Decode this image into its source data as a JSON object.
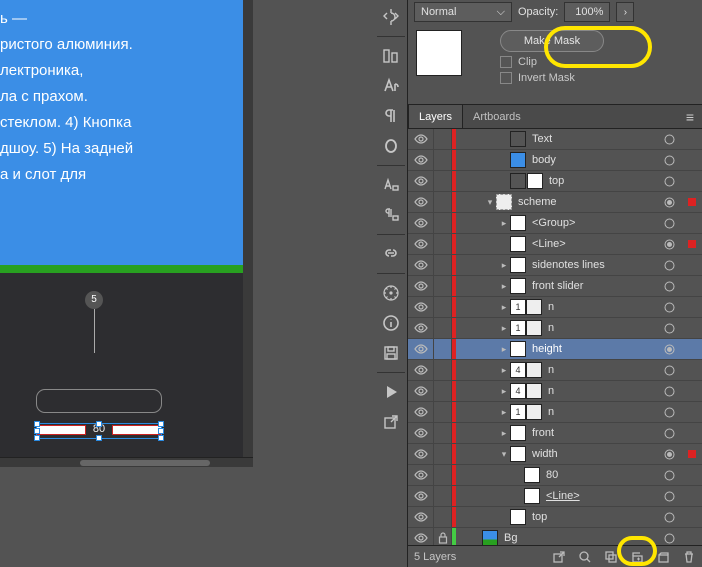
{
  "canvas": {
    "paragraph": "ь — \nристого алюминия. \nлектроника, \nла с прахом. \n стеклом. 4) Кнопка \nдшоу. 5) На задней \nа и слот для",
    "callout_number": "5",
    "sel_label": "80"
  },
  "transparency": {
    "blend_mode": "Normal",
    "opacity_label": "Opacity:",
    "opacity_value": "100%",
    "make_mask": "Make Mask",
    "clip": "Clip",
    "invert": "Invert Mask"
  },
  "layers_panel": {
    "tab_layers": "Layers",
    "tab_artboards": "Artboards",
    "rows": [
      {
        "vis": 1,
        "edge": "r",
        "depth": 3,
        "tw": "",
        "thumb": "dark",
        "name": "Text",
        "t": 1
      },
      {
        "vis": 1,
        "edge": "r",
        "depth": 3,
        "tw": "",
        "thumb": "blue",
        "name": "body",
        "t": 1
      },
      {
        "vis": 1,
        "edge": "r",
        "depth": 3,
        "tw": "",
        "double": null,
        "thumb": "dark",
        "extra": "white",
        "name": "top",
        "t": 1
      },
      {
        "vis": 1,
        "edge": "r",
        "depth": 2,
        "tw": "v",
        "thumb2": "white",
        "name": "scheme",
        "t": 1,
        "sq": 1,
        "tgtfill": 1
      },
      {
        "vis": 1,
        "edge": "r",
        "depth": 3,
        "tw": ">",
        "thumb": "white",
        "name": "<Group>",
        "t": 1
      },
      {
        "vis": 1,
        "edge": "r",
        "depth": 3,
        "tw": "",
        "thumb": "white",
        "name": "<Line>",
        "t": 1,
        "sq": 1,
        "tgtfill": 1
      },
      {
        "vis": 1,
        "edge": "r",
        "depth": 3,
        "tw": ">",
        "thumb": "white",
        "name": "sidenotes lines",
        "t": 1
      },
      {
        "vis": 1,
        "edge": "r",
        "depth": 3,
        "tw": ">",
        "thumb": "white",
        "name": "front slider",
        "t": 1
      },
      {
        "vis": 1,
        "edge": "r",
        "depth": 3,
        "tw": ">",
        "double": "1",
        "name": "n",
        "t": 1
      },
      {
        "vis": 1,
        "edge": "r",
        "depth": 3,
        "tw": ">",
        "double": "1",
        "name": "n",
        "t": 1
      },
      {
        "vis": 1,
        "edge": "r",
        "depth": 3,
        "tw": ">",
        "thumb": "white",
        "name": "height",
        "sel": 1,
        "t": 1,
        "tgtfill": 1
      },
      {
        "vis": 1,
        "edge": "r",
        "depth": 3,
        "tw": ">",
        "double": "4",
        "name": "n",
        "t": 1
      },
      {
        "vis": 1,
        "edge": "r",
        "depth": 3,
        "tw": ">",
        "double": "4",
        "name": "n",
        "t": 1
      },
      {
        "vis": 1,
        "edge": "r",
        "depth": 3,
        "tw": ">",
        "double": "1",
        "name": "n",
        "t": 1
      },
      {
        "vis": 1,
        "edge": "r",
        "depth": 3,
        "tw": ">",
        "thumb": "white",
        "name": "front",
        "t": 1
      },
      {
        "vis": 1,
        "edge": "r",
        "depth": 3,
        "tw": "v",
        "thumb": "white",
        "name": "width",
        "t": 1,
        "sq": 1,
        "tgtfill": 1
      },
      {
        "vis": 1,
        "edge": "r",
        "depth": 4,
        "tw": "",
        "thumb": "white",
        "name": "80",
        "t": 1
      },
      {
        "vis": 1,
        "edge": "r",
        "depth": 4,
        "tw": "",
        "thumb": "white",
        "name": "<Line>",
        "ul": 1,
        "t": 1
      },
      {
        "vis": 1,
        "edge": "r",
        "depth": 3,
        "tw": "",
        "thumb": "white",
        "name": "top",
        "t": 1
      },
      {
        "vis": 1,
        "edge": "g",
        "depth": 1,
        "tw": "",
        "thumb": "img",
        "name": "Bg",
        "lock": 1,
        "t": 1
      }
    ],
    "footer_count": "5 Layers"
  }
}
